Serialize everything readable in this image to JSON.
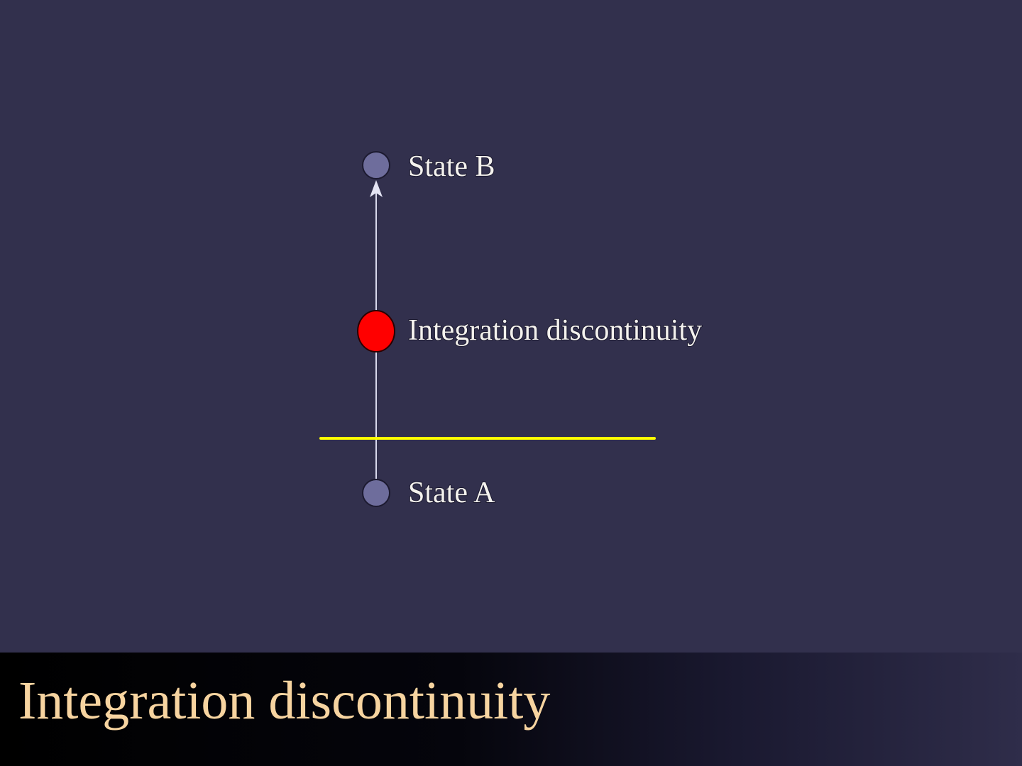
{
  "diagram": {
    "nodes": {
      "state_b": {
        "label": "State B",
        "color": "#6e6d9c"
      },
      "discontinuity": {
        "label": "Integration discontinuity",
        "color": "#ff0000"
      },
      "state_a": {
        "label": "State A",
        "color": "#6e6d9c"
      }
    },
    "edge": {
      "from": "State A",
      "to": "State B",
      "color": "#d8d8ec"
    },
    "threshold_line_color": "#ffff00"
  },
  "title": "Integration discontinuity",
  "colors": {
    "background": "#32304d",
    "title_text": "#f7d4a0"
  }
}
